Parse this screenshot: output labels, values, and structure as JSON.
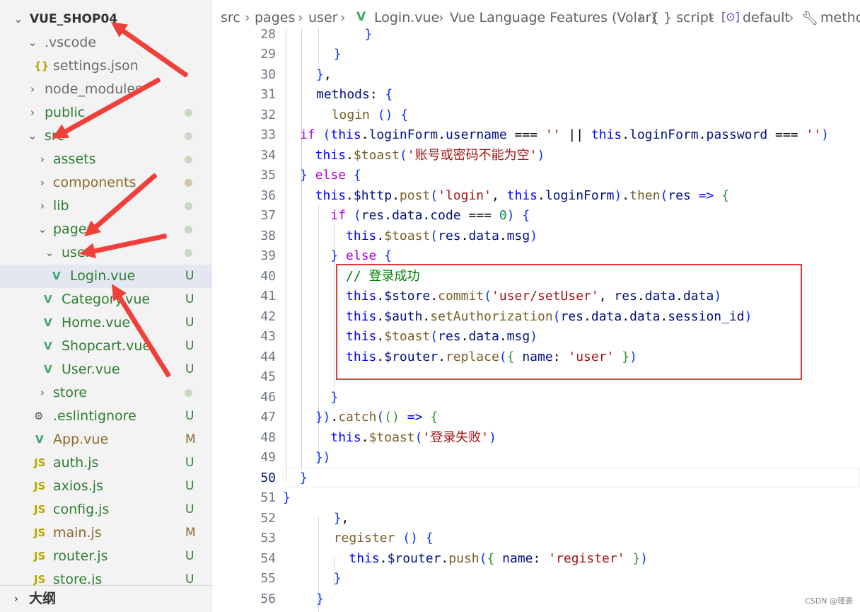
{
  "explorer": {
    "items": [
      {
        "label": "VUE_SHOP04",
        "kind": "root"
      },
      {
        "label": ".vscode",
        "kind": "folder-open"
      },
      {
        "label": "settings.json",
        "kind": "json"
      },
      {
        "label": "node_modules",
        "kind": "folder"
      },
      {
        "label": "public",
        "kind": "folder"
      },
      {
        "label": "src",
        "kind": "folder-open"
      },
      {
        "label": "assets",
        "kind": "folder"
      },
      {
        "label": "components",
        "kind": "folder"
      },
      {
        "label": "lib",
        "kind": "folder"
      },
      {
        "label": "pages",
        "kind": "folder-open"
      },
      {
        "label": "user",
        "kind": "folder-open"
      },
      {
        "label": "Login.vue",
        "kind": "vue",
        "badge": "U"
      },
      {
        "label": "Category.vue",
        "kind": "vue",
        "badge": "U"
      },
      {
        "label": "Home.vue",
        "kind": "vue",
        "badge": "U"
      },
      {
        "label": "Shopcart.vue",
        "kind": "vue",
        "badge": "U"
      },
      {
        "label": "User.vue",
        "kind": "vue",
        "badge": "U"
      },
      {
        "label": "store",
        "kind": "folder"
      },
      {
        "label": ".eslintignore",
        "kind": "config",
        "badge": "U"
      },
      {
        "label": "App.vue",
        "kind": "vue",
        "badge": "M"
      },
      {
        "label": "auth.js",
        "kind": "js",
        "badge": "U"
      },
      {
        "label": "axios.js",
        "kind": "js",
        "badge": "U"
      },
      {
        "label": "config.js",
        "kind": "js",
        "badge": "U"
      },
      {
        "label": "main.js",
        "kind": "js",
        "badge": "M"
      },
      {
        "label": "router.js",
        "kind": "js",
        "badge": "U"
      },
      {
        "label": "store.js",
        "kind": "js",
        "badge": "U"
      }
    ],
    "outline_label": "大纲"
  },
  "breadcrumb": {
    "items": [
      "src",
      "pages",
      "user",
      "Login.vue",
      "Vue Language Features (Volar)",
      "{ } script",
      "default",
      "metho"
    ]
  },
  "editor": {
    "active_line": "50",
    "lines": [
      {
        "n": "28",
        "text": "    }"
      },
      {
        "n": "29",
        "text": "  }"
      },
      {
        "n": "30",
        "text": "},"
      },
      {
        "n": "31",
        "text": "methods: {"
      },
      {
        "n": "32",
        "text": "  login () {"
      },
      {
        "n": "33",
        "text": "if (this.loginForm.username === '' || this.loginForm.password === '')"
      },
      {
        "n": "34",
        "text": "  this.$toast('账号或密码不能为空')"
      },
      {
        "n": "35",
        "text": "} else {"
      },
      {
        "n": "36",
        "text": "  this.$http.post('login', this.loginForm).then(res => {"
      },
      {
        "n": "37",
        "text": "    if (res.data.code === 0) {"
      },
      {
        "n": "38",
        "text": "      this.$toast(res.data.msg)"
      },
      {
        "n": "39",
        "text": "    } else {"
      },
      {
        "n": "40",
        "text": "      // 登录成功"
      },
      {
        "n": "41",
        "text": "      this.$store.commit('user/setUser', res.data.data)"
      },
      {
        "n": "42",
        "text": "      this.$auth.setAuthorization(res.data.data.session_id)"
      },
      {
        "n": "43",
        "text": "      this.$toast(res.data.msg)"
      },
      {
        "n": "44",
        "text": "      this.$router.replace({ name: 'user' })"
      },
      {
        "n": "45",
        "text": ""
      },
      {
        "n": "46",
        "text": "    }"
      },
      {
        "n": "47",
        "text": "  }).catch(() => {"
      },
      {
        "n": "48",
        "text": "    this.$toast('登录失败')"
      },
      {
        "n": "49",
        "text": "  })"
      },
      {
        "n": "50",
        "text": "}"
      },
      {
        "n": "51",
        "text": "}"
      },
      {
        "n": "52",
        "text": "  },"
      },
      {
        "n": "53",
        "text": "  register () {"
      },
      {
        "n": "54",
        "text": "    this.$router.push({ name: 'register' })"
      },
      {
        "n": "55",
        "text": "  }"
      },
      {
        "n": "56",
        "text": "}"
      }
    ]
  },
  "watermark": "CSDN @瑾寰",
  "colors": {
    "highlight_box": "#e03a3a",
    "annotation_arrow": "#f0403a",
    "untracked": "#2e7d32",
    "modified": "#8b6a2b"
  }
}
